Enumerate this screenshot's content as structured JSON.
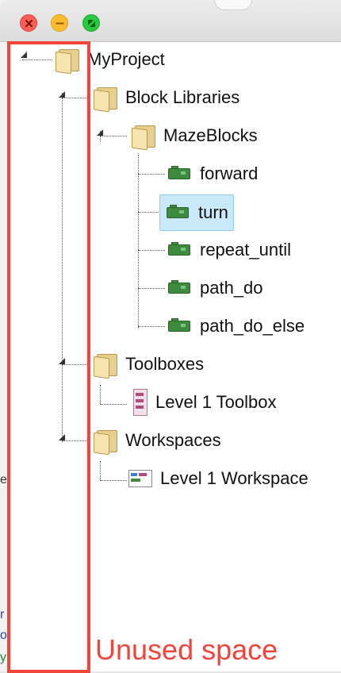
{
  "window": {
    "traffic_lights": [
      "close",
      "minimize",
      "maximize"
    ]
  },
  "background_fragments": {
    "mid_letter": "e",
    "bottom_1": "r",
    "bottom_2": "o",
    "bottom_3": "y"
  },
  "tree": {
    "root": {
      "label": "MyProject",
      "icon": "folder-icon"
    },
    "block_libraries": {
      "label": "Block Libraries",
      "icon": "folder-icon"
    },
    "maze_blocks": {
      "label": "MazeBlocks",
      "icon": "folder-icon"
    },
    "blocks": [
      {
        "label": "forward",
        "icon": "block-icon"
      },
      {
        "label": "turn",
        "icon": "block-icon",
        "selected": true
      },
      {
        "label": "repeat_until",
        "icon": "block-icon"
      },
      {
        "label": "path_do",
        "icon": "block-icon"
      },
      {
        "label": "path_do_else",
        "icon": "block-icon"
      }
    ],
    "toolboxes": {
      "label": "Toolboxes",
      "icon": "folder-icon"
    },
    "toolbox_item": {
      "label": "Level 1 Toolbox",
      "icon": "toolbox-icon"
    },
    "workspaces": {
      "label": "Workspaces",
      "icon": "folder-icon"
    },
    "workspace_item": {
      "label": "Level 1 Workspace",
      "icon": "workspace-icon"
    }
  },
  "annotation": {
    "label": "Unused space",
    "color": "#f2453a"
  },
  "colors": {
    "selection_bg": "#c9e9fb",
    "block_green": "#3e8a3e",
    "folder_yellow": "#e9cf8e"
  }
}
